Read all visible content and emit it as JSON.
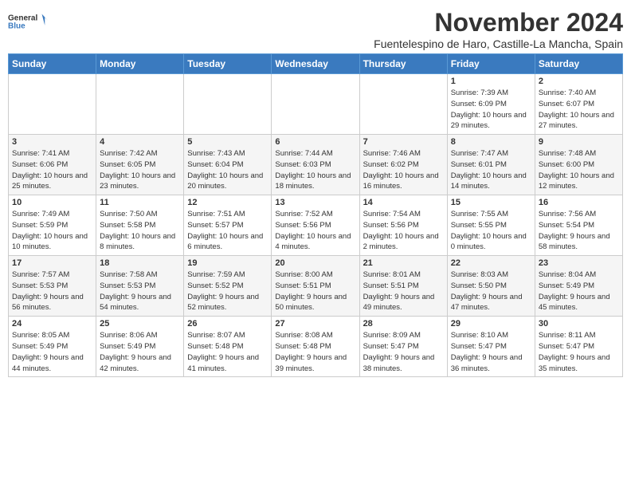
{
  "header": {
    "logo_general": "General",
    "logo_blue": "Blue",
    "month_title": "November 2024",
    "location": "Fuentelespino de Haro, Castille-La Mancha, Spain"
  },
  "weekdays": [
    "Sunday",
    "Monday",
    "Tuesday",
    "Wednesday",
    "Thursday",
    "Friday",
    "Saturday"
  ],
  "weeks": [
    [
      {
        "day": "",
        "info": ""
      },
      {
        "day": "",
        "info": ""
      },
      {
        "day": "",
        "info": ""
      },
      {
        "day": "",
        "info": ""
      },
      {
        "day": "",
        "info": ""
      },
      {
        "day": "1",
        "info": "Sunrise: 7:39 AM\nSunset: 6:09 PM\nDaylight: 10 hours and 29 minutes."
      },
      {
        "day": "2",
        "info": "Sunrise: 7:40 AM\nSunset: 6:07 PM\nDaylight: 10 hours and 27 minutes."
      }
    ],
    [
      {
        "day": "3",
        "info": "Sunrise: 7:41 AM\nSunset: 6:06 PM\nDaylight: 10 hours and 25 minutes."
      },
      {
        "day": "4",
        "info": "Sunrise: 7:42 AM\nSunset: 6:05 PM\nDaylight: 10 hours and 23 minutes."
      },
      {
        "day": "5",
        "info": "Sunrise: 7:43 AM\nSunset: 6:04 PM\nDaylight: 10 hours and 20 minutes."
      },
      {
        "day": "6",
        "info": "Sunrise: 7:44 AM\nSunset: 6:03 PM\nDaylight: 10 hours and 18 minutes."
      },
      {
        "day": "7",
        "info": "Sunrise: 7:46 AM\nSunset: 6:02 PM\nDaylight: 10 hours and 16 minutes."
      },
      {
        "day": "8",
        "info": "Sunrise: 7:47 AM\nSunset: 6:01 PM\nDaylight: 10 hours and 14 minutes."
      },
      {
        "day": "9",
        "info": "Sunrise: 7:48 AM\nSunset: 6:00 PM\nDaylight: 10 hours and 12 minutes."
      }
    ],
    [
      {
        "day": "10",
        "info": "Sunrise: 7:49 AM\nSunset: 5:59 PM\nDaylight: 10 hours and 10 minutes."
      },
      {
        "day": "11",
        "info": "Sunrise: 7:50 AM\nSunset: 5:58 PM\nDaylight: 10 hours and 8 minutes."
      },
      {
        "day": "12",
        "info": "Sunrise: 7:51 AM\nSunset: 5:57 PM\nDaylight: 10 hours and 6 minutes."
      },
      {
        "day": "13",
        "info": "Sunrise: 7:52 AM\nSunset: 5:56 PM\nDaylight: 10 hours and 4 minutes."
      },
      {
        "day": "14",
        "info": "Sunrise: 7:54 AM\nSunset: 5:56 PM\nDaylight: 10 hours and 2 minutes."
      },
      {
        "day": "15",
        "info": "Sunrise: 7:55 AM\nSunset: 5:55 PM\nDaylight: 10 hours and 0 minutes."
      },
      {
        "day": "16",
        "info": "Sunrise: 7:56 AM\nSunset: 5:54 PM\nDaylight: 9 hours and 58 minutes."
      }
    ],
    [
      {
        "day": "17",
        "info": "Sunrise: 7:57 AM\nSunset: 5:53 PM\nDaylight: 9 hours and 56 minutes."
      },
      {
        "day": "18",
        "info": "Sunrise: 7:58 AM\nSunset: 5:53 PM\nDaylight: 9 hours and 54 minutes."
      },
      {
        "day": "19",
        "info": "Sunrise: 7:59 AM\nSunset: 5:52 PM\nDaylight: 9 hours and 52 minutes."
      },
      {
        "day": "20",
        "info": "Sunrise: 8:00 AM\nSunset: 5:51 PM\nDaylight: 9 hours and 50 minutes."
      },
      {
        "day": "21",
        "info": "Sunrise: 8:01 AM\nSunset: 5:51 PM\nDaylight: 9 hours and 49 minutes."
      },
      {
        "day": "22",
        "info": "Sunrise: 8:03 AM\nSunset: 5:50 PM\nDaylight: 9 hours and 47 minutes."
      },
      {
        "day": "23",
        "info": "Sunrise: 8:04 AM\nSunset: 5:49 PM\nDaylight: 9 hours and 45 minutes."
      }
    ],
    [
      {
        "day": "24",
        "info": "Sunrise: 8:05 AM\nSunset: 5:49 PM\nDaylight: 9 hours and 44 minutes."
      },
      {
        "day": "25",
        "info": "Sunrise: 8:06 AM\nSunset: 5:49 PM\nDaylight: 9 hours and 42 minutes."
      },
      {
        "day": "26",
        "info": "Sunrise: 8:07 AM\nSunset: 5:48 PM\nDaylight: 9 hours and 41 minutes."
      },
      {
        "day": "27",
        "info": "Sunrise: 8:08 AM\nSunset: 5:48 PM\nDaylight: 9 hours and 39 minutes."
      },
      {
        "day": "28",
        "info": "Sunrise: 8:09 AM\nSunset: 5:47 PM\nDaylight: 9 hours and 38 minutes."
      },
      {
        "day": "29",
        "info": "Sunrise: 8:10 AM\nSunset: 5:47 PM\nDaylight: 9 hours and 36 minutes."
      },
      {
        "day": "30",
        "info": "Sunrise: 8:11 AM\nSunset: 5:47 PM\nDaylight: 9 hours and 35 minutes."
      }
    ]
  ]
}
